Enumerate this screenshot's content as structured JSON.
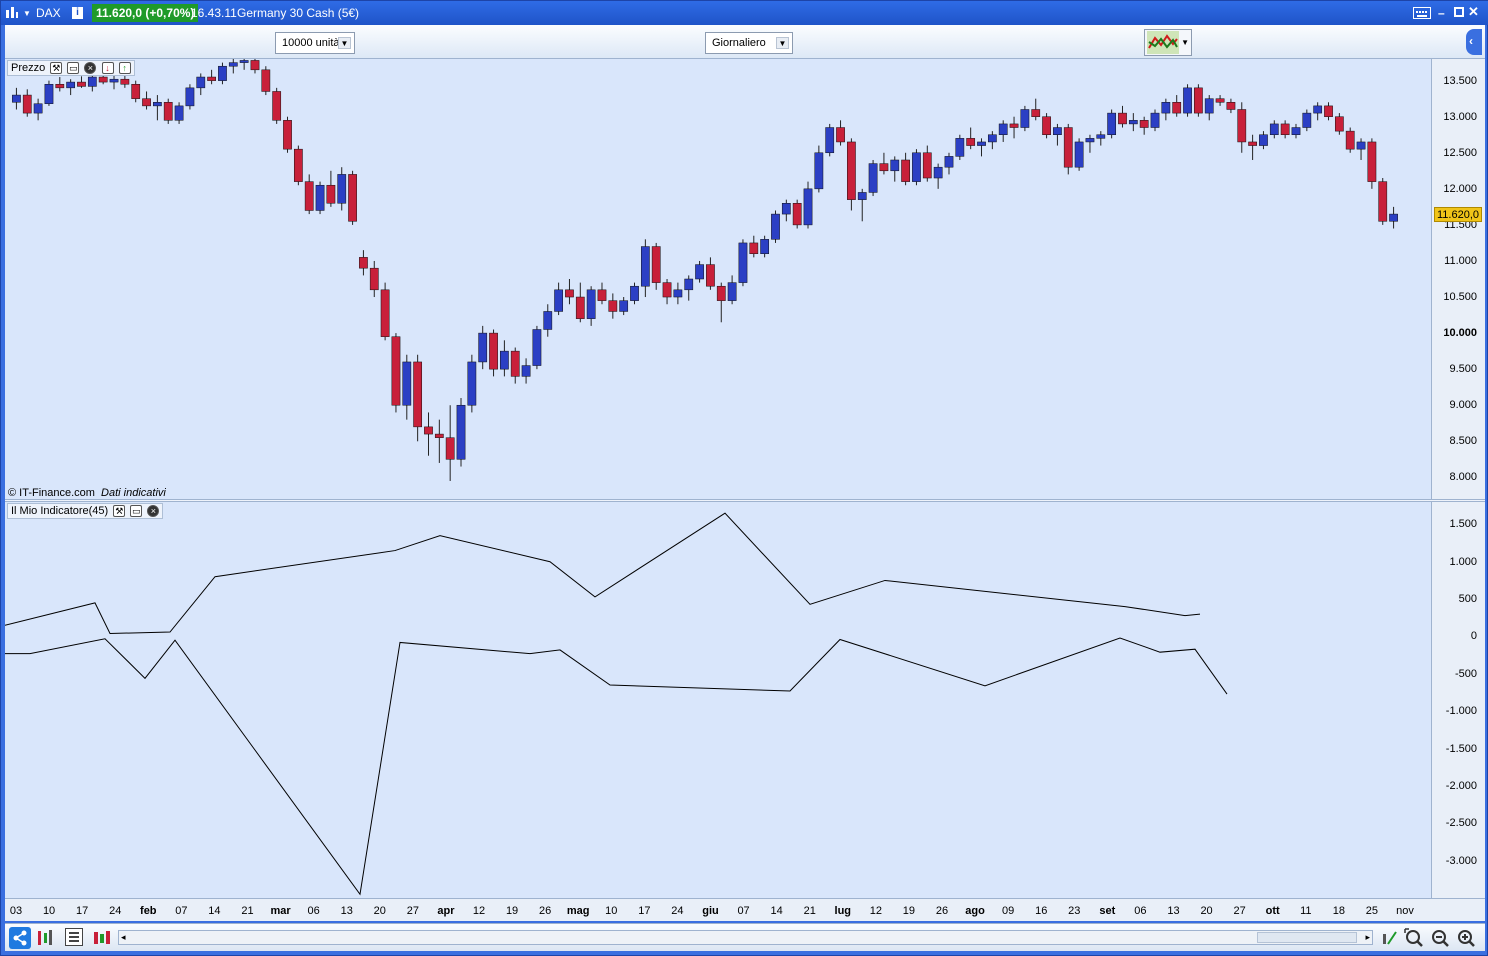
{
  "window": {
    "symbol": "DAX",
    "info_icon": "info-icon",
    "price_badge": "11.620,0 (+0,70%)",
    "time": "16.43.11",
    "instrument": "Germany 30 Cash (5€)",
    "controls": [
      "keyboard-icon",
      "minimize-icon",
      "maximize-icon",
      "close-icon"
    ]
  },
  "toolbar": {
    "units_value": "10000 unità",
    "period_value": "Giornaliero"
  },
  "price_panel": {
    "title": "Prezzo",
    "copyright": "© IT-Finance.com",
    "data_note": "Dati indicativi",
    "current_price_label": "11.620,0",
    "y_ticks": [
      "13.500",
      "13.000",
      "12.500",
      "12.000",
      "11.500",
      "11.000",
      "10.500",
      "10.000",
      "9.500",
      "9.000",
      "8.500",
      "8.000"
    ]
  },
  "indicator_panel": {
    "title": "Il Mio Indicatore(45)",
    "y_ticks": [
      "1.500",
      "1.000",
      "500",
      "0",
      "-500",
      "-1.000",
      "-1.500",
      "-2.000",
      "-2.500",
      "-3.000"
    ]
  },
  "x_axis": {
    "labels": [
      {
        "t": "03",
        "b": false
      },
      {
        "t": "10",
        "b": false
      },
      {
        "t": "17",
        "b": false
      },
      {
        "t": "24",
        "b": false
      },
      {
        "t": "feb",
        "b": true
      },
      {
        "t": "07",
        "b": false
      },
      {
        "t": "14",
        "b": false
      },
      {
        "t": "21",
        "b": false
      },
      {
        "t": "mar",
        "b": true
      },
      {
        "t": "06",
        "b": false
      },
      {
        "t": "13",
        "b": false
      },
      {
        "t": "20",
        "b": false
      },
      {
        "t": "27",
        "b": false
      },
      {
        "t": "apr",
        "b": true
      },
      {
        "t": "12",
        "b": false
      },
      {
        "t": "19",
        "b": false
      },
      {
        "t": "26",
        "b": false
      },
      {
        "t": "mag",
        "b": true
      },
      {
        "t": "10",
        "b": false
      },
      {
        "t": "17",
        "b": false
      },
      {
        "t": "24",
        "b": false
      },
      {
        "t": "giu",
        "b": true
      },
      {
        "t": "07",
        "b": false
      },
      {
        "t": "14",
        "b": false
      },
      {
        "t": "21",
        "b": false
      },
      {
        "t": "lug",
        "b": true
      },
      {
        "t": "12",
        "b": false
      },
      {
        "t": "19",
        "b": false
      },
      {
        "t": "26",
        "b": false
      },
      {
        "t": "ago",
        "b": true
      },
      {
        "t": "09",
        "b": false
      },
      {
        "t": "16",
        "b": false
      },
      {
        "t": "23",
        "b": false
      },
      {
        "t": "set",
        "b": true
      },
      {
        "t": "06",
        "b": false
      },
      {
        "t": "13",
        "b": false
      },
      {
        "t": "20",
        "b": false
      },
      {
        "t": "27",
        "b": false
      },
      {
        "t": "ott",
        "b": true
      },
      {
        "t": "11",
        "b": false
      },
      {
        "t": "18",
        "b": false
      },
      {
        "t": "25",
        "b": false
      },
      {
        "t": "nov",
        "b": false
      }
    ]
  },
  "colors": {
    "up": "#2b3fc4",
    "down": "#c8203a",
    "background": "#d9e6fb",
    "badge": "#1f9a2a",
    "price_marker": "#f0c419"
  },
  "chart_data": [
    {
      "type": "candlestick",
      "title": "Prezzo",
      "ylim": [
        7700,
        13800
      ],
      "candles": [
        [
          13200,
          13400,
          13100,
          13300
        ],
        [
          13300,
          13380,
          13000,
          13050
        ],
        [
          13050,
          13250,
          12950,
          13180
        ],
        [
          13180,
          13500,
          13150,
          13450
        ],
        [
          13450,
          13550,
          13350,
          13400
        ],
        [
          13400,
          13520,
          13300,
          13480
        ],
        [
          13480,
          13560,
          13400,
          13420
        ],
        [
          13420,
          13600,
          13350,
          13550
        ],
        [
          13550,
          13620,
          13450,
          13480
        ],
        [
          13480,
          13580,
          13380,
          13520
        ],
        [
          13520,
          13600,
          13400,
          13450
        ],
        [
          13450,
          13500,
          13200,
          13250
        ],
        [
          13250,
          13350,
          13100,
          13150
        ],
        [
          13150,
          13300,
          12950,
          13200
        ],
        [
          13200,
          13250,
          12900,
          12950
        ],
        [
          12950,
          13200,
          12900,
          13150
        ],
        [
          13150,
          13450,
          13100,
          13400
        ],
        [
          13400,
          13600,
          13300,
          13550
        ],
        [
          13550,
          13650,
          13450,
          13500
        ],
        [
          13500,
          13750,
          13450,
          13700
        ],
        [
          13700,
          13800,
          13600,
          13750
        ],
        [
          13750,
          13820,
          13650,
          13780
        ],
        [
          13780,
          13800,
          13600,
          13650
        ],
        [
          13650,
          13700,
          13300,
          13350
        ],
        [
          13350,
          13400,
          12900,
          12950
        ],
        [
          12950,
          13000,
          12500,
          12550
        ],
        [
          12550,
          12600,
          12050,
          12100
        ],
        [
          12100,
          12200,
          11650,
          11700
        ],
        [
          11700,
          12100,
          11650,
          12050
        ],
        [
          12050,
          12250,
          11750,
          11800
        ],
        [
          11800,
          12300,
          11700,
          12200
        ],
        [
          12200,
          12250,
          11500,
          11550
        ],
        [
          11050,
          11150,
          10800,
          10900
        ],
        [
          10900,
          11000,
          10500,
          10600
        ],
        [
          10600,
          10700,
          9900,
          9950
        ],
        [
          9950,
          10000,
          8900,
          9000
        ],
        [
          9000,
          9700,
          8800,
          9600
        ],
        [
          9600,
          9700,
          8500,
          8700
        ],
        [
          8700,
          8900,
          8300,
          8600
        ],
        [
          8600,
          8800,
          8200,
          8550
        ],
        [
          8550,
          9000,
          7950,
          8250
        ],
        [
          8250,
          9100,
          8150,
          9000
        ],
        [
          9000,
          9700,
          8900,
          9600
        ],
        [
          9600,
          10100,
          9500,
          10000
        ],
        [
          10000,
          10050,
          9400,
          9500
        ],
        [
          9500,
          9900,
          9400,
          9750
        ],
        [
          9750,
          9800,
          9300,
          9400
        ],
        [
          9400,
          9650,
          9300,
          9550
        ],
        [
          9550,
          10100,
          9500,
          10050
        ],
        [
          10050,
          10400,
          9950,
          10300
        ],
        [
          10300,
          10700,
          10250,
          10600
        ],
        [
          10600,
          10750,
          10400,
          10500
        ],
        [
          10500,
          10700,
          10150,
          10200
        ],
        [
          10200,
          10650,
          10100,
          10600
        ],
        [
          10600,
          10700,
          10400,
          10450
        ],
        [
          10450,
          10550,
          10200,
          10300
        ],
        [
          10300,
          10500,
          10250,
          10450
        ],
        [
          10450,
          10700,
          10400,
          10650
        ],
        [
          10650,
          11300,
          10500,
          11200
        ],
        [
          11200,
          11250,
          10600,
          10700
        ],
        [
          10700,
          10750,
          10400,
          10500
        ],
        [
          10500,
          10700,
          10400,
          10600
        ],
        [
          10600,
          10800,
          10450,
          10750
        ],
        [
          10750,
          11000,
          10700,
          10950
        ],
        [
          10950,
          11050,
          10600,
          10650
        ],
        [
          10650,
          10700,
          10150,
          10450
        ],
        [
          10450,
          10800,
          10400,
          10700
        ],
        [
          10700,
          11300,
          10650,
          11250
        ],
        [
          11250,
          11350,
          11050,
          11100
        ],
        [
          11100,
          11350,
          11050,
          11300
        ],
        [
          11300,
          11700,
          11250,
          11650
        ],
        [
          11650,
          11850,
          11550,
          11800
        ],
        [
          11800,
          11850,
          11450,
          11500
        ],
        [
          11500,
          12100,
          11450,
          12000
        ],
        [
          12000,
          12600,
          11950,
          12500
        ],
        [
          12500,
          12900,
          12450,
          12850
        ],
        [
          12850,
          12950,
          12600,
          12650
        ],
        [
          12650,
          12700,
          11700,
          11850
        ],
        [
          11850,
          12000,
          11550,
          11950
        ],
        [
          11950,
          12400,
          11900,
          12350
        ],
        [
          12350,
          12500,
          12200,
          12250
        ],
        [
          12250,
          12450,
          12100,
          12400
        ],
        [
          12400,
          12500,
          12050,
          12100
        ],
        [
          12100,
          12550,
          12050,
          12500
        ],
        [
          12500,
          12600,
          12100,
          12150
        ],
        [
          12150,
          12350,
          12000,
          12300
        ],
        [
          12300,
          12500,
          12200,
          12450
        ],
        [
          12450,
          12750,
          12400,
          12700
        ],
        [
          12700,
          12850,
          12550,
          12600
        ],
        [
          12600,
          12700,
          12450,
          12650
        ],
        [
          12650,
          12800,
          12550,
          12750
        ],
        [
          12750,
          12950,
          12650,
          12900
        ],
        [
          12900,
          13000,
          12700,
          12850
        ],
        [
          12850,
          13150,
          12800,
          13100
        ],
        [
          13100,
          13250,
          12950,
          13000
        ],
        [
          13000,
          13050,
          12700,
          12750
        ],
        [
          12750,
          12900,
          12600,
          12850
        ],
        [
          12850,
          12900,
          12200,
          12300
        ],
        [
          12300,
          12700,
          12250,
          12650
        ],
        [
          12650,
          12750,
          12500,
          12700
        ],
        [
          12700,
          12800,
          12600,
          12750
        ],
        [
          12750,
          13100,
          12700,
          13050
        ],
        [
          13050,
          13150,
          12850,
          12900
        ],
        [
          12900,
          13050,
          12800,
          12950
        ],
        [
          12950,
          13000,
          12750,
          12850
        ],
        [
          12850,
          13100,
          12800,
          13050
        ],
        [
          13050,
          13250,
          12950,
          13200
        ],
        [
          13200,
          13300,
          13000,
          13050
        ],
        [
          13050,
          13450,
          13000,
          13400
        ],
        [
          13400,
          13450,
          13000,
          13050
        ],
        [
          13050,
          13300,
          12950,
          13250
        ],
        [
          13250,
          13300,
          13150,
          13200
        ],
        [
          13200,
          13250,
          13050,
          13100
        ],
        [
          13100,
          13200,
          12500,
          12650
        ],
        [
          12650,
          12750,
          12400,
          12600
        ],
        [
          12600,
          12800,
          12550,
          12750
        ],
        [
          12750,
          12950,
          12700,
          12900
        ],
        [
          12900,
          12950,
          12700,
          12750
        ],
        [
          12750,
          12900,
          12700,
          12850
        ],
        [
          12850,
          13100,
          12800,
          13050
        ],
        [
          13050,
          13200,
          12950,
          13150
        ],
        [
          13150,
          13200,
          12950,
          13000
        ],
        [
          13000,
          13050,
          12750,
          12800
        ],
        [
          12800,
          12850,
          12500,
          12550
        ],
        [
          12550,
          12700,
          12400,
          12650
        ],
        [
          12650,
          12700,
          12000,
          12100
        ],
        [
          12100,
          12150,
          11500,
          11550
        ],
        [
          11550,
          11750,
          11450,
          11650
        ]
      ]
    },
    {
      "type": "line",
      "title": "Il Mio Indicatore(45)",
      "ylim": [
        -3500,
        1800
      ],
      "series": [
        {
          "values": [
            150,
            450,
            40,
            60,
            800,
            1150,
            1350,
            1000,
            530,
            1650,
            430,
            750,
            400,
            280,
            300
          ],
          "x": [
            0,
            90,
            105,
            165,
            210,
            390,
            435,
            545,
            590,
            720,
            805,
            880,
            1120,
            1180,
            1195
          ]
        },
        {
          "values": [
            -230,
            -230,
            -30,
            -560,
            -50,
            -3450,
            -80,
            -230,
            -180,
            -650,
            -730,
            -40,
            -660,
            -20,
            -210,
            -170,
            -770
          ],
          "x": [
            0,
            25,
            100,
            140,
            170,
            355,
            395,
            525,
            555,
            605,
            785,
            835,
            980,
            1115,
            1155,
            1190,
            1222
          ]
        }
      ]
    }
  ]
}
